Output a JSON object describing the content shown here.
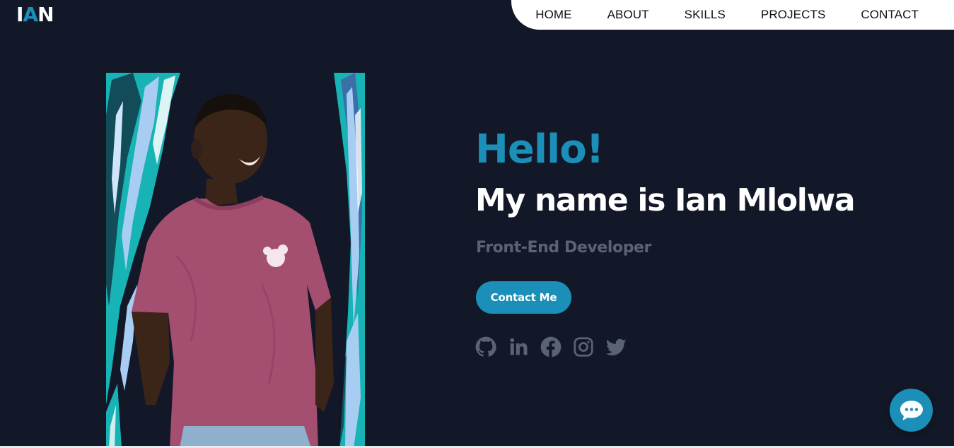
{
  "logo": {
    "part1": "I",
    "part2": "A",
    "part3": "N"
  },
  "nav": {
    "items": [
      {
        "label": "HOME"
      },
      {
        "label": "ABOUT"
      },
      {
        "label": "SKILLS"
      },
      {
        "label": "PROJECTS"
      },
      {
        "label": "CONTACT"
      }
    ]
  },
  "hero": {
    "greeting": "Hello!",
    "name": "My name is Ian Mlolwa",
    "role": "Front-End Developer",
    "cta_label": "Contact Me",
    "photo_subject": "portrait of a smiling man in a maroon t-shirt on a blue brush-stroke background"
  },
  "socials": [
    {
      "icon": "github-icon"
    },
    {
      "icon": "linkedin-icon"
    },
    {
      "icon": "facebook-icon"
    },
    {
      "icon": "instagram-icon"
    },
    {
      "icon": "twitter-icon"
    }
  ],
  "chat": {
    "icon": "chat-bubble-icon"
  },
  "colors": {
    "background": "#131828",
    "accent": "#1b8fb8",
    "muted": "#5a6374",
    "nav_bg": "#ffffff"
  }
}
